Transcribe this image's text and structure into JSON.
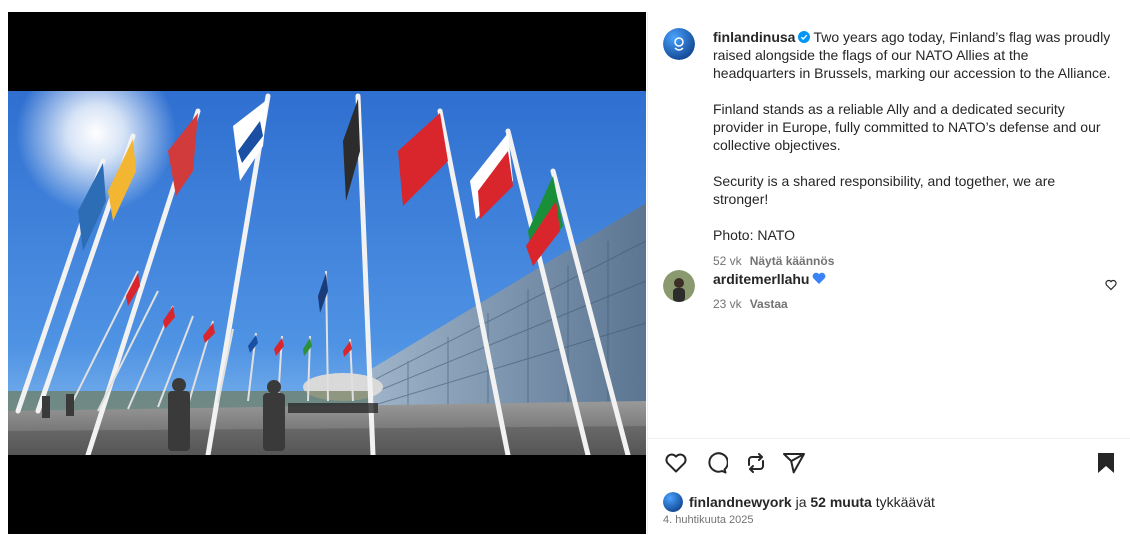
{
  "post": {
    "author": "finlandinusa",
    "caption_first": "Two years ago today, Finland’s flag was proudly raised alongside the flags of our NATO Allies at the headquarters in Brussels, marking our accession to the Alliance.",
    "caption_p2": "Finland stands as a reliable Ally and a dedicated security provider in Europe, fully committed to NATO’s defense and our collective objectives.",
    "caption_p3": "Security is a shared responsibility, and together, we are stronger!",
    "caption_p4": "Photo: NATO",
    "age": "52 vk",
    "translate_label": "Näytä käännös"
  },
  "comment": {
    "author": "arditemerllahu",
    "age": "23 vk",
    "reply_label": "Vastaa"
  },
  "likes": {
    "liker": "finlandnewyork",
    "joiner": " ja ",
    "others": "52 muuta",
    "suffix": " tykkäävät"
  },
  "date": "4. huhtikuuta 2025",
  "icons": {
    "like": "heart-icon",
    "comment": "comment-icon",
    "repost": "repost-icon",
    "share": "share-icon",
    "save": "bookmark-icon",
    "verified": "verified-badge-icon",
    "comment_like": "heart-icon"
  },
  "colors": {
    "verified": "#0095f6",
    "heart_blue": "#3b82f6",
    "sky": "#3b82d6",
    "text": "#262626",
    "muted": "#737373"
  }
}
